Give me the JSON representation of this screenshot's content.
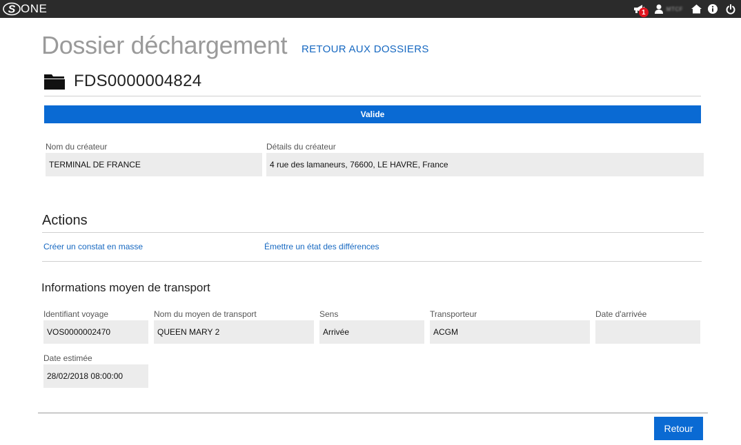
{
  "topbar": {
    "logo_text": "ONE",
    "notification_count": "1",
    "user_name": "MTCF"
  },
  "header": {
    "title": "Dossier déchargement",
    "back_link": "RETOUR AUX DOSSIERS",
    "dossier_id": "FDS0000004824"
  },
  "status": {
    "label": "Valide",
    "color": "#0a6ad3"
  },
  "creator": {
    "name_label": "Nom du créateur",
    "name_value": "TERMINAL DE FRANCE",
    "details_label": "Détails du créateur",
    "details_value": "4 rue des lamaneurs, 76600, LE HAVRE, France"
  },
  "actions": {
    "title": "Actions",
    "items": [
      {
        "label": "Créer un constat en masse"
      },
      {
        "label": "Émettre un état des différences"
      }
    ]
  },
  "transport": {
    "title": "Informations moyen de transport",
    "fields": [
      {
        "label": "Identifiant voyage",
        "value": "VOS0000002470"
      },
      {
        "label": "Nom du moyen de transport",
        "value": "QUEEN MARY 2"
      },
      {
        "label": "Sens",
        "value": "Arrivée"
      },
      {
        "label": "Transporteur",
        "value": "ACGM"
      },
      {
        "label": "Date d'arrivée",
        "value": ""
      },
      {
        "label": "Date estimée",
        "value": "28/02/2018 08:00:00"
      }
    ]
  },
  "footer": {
    "retour_label": "Retour"
  }
}
